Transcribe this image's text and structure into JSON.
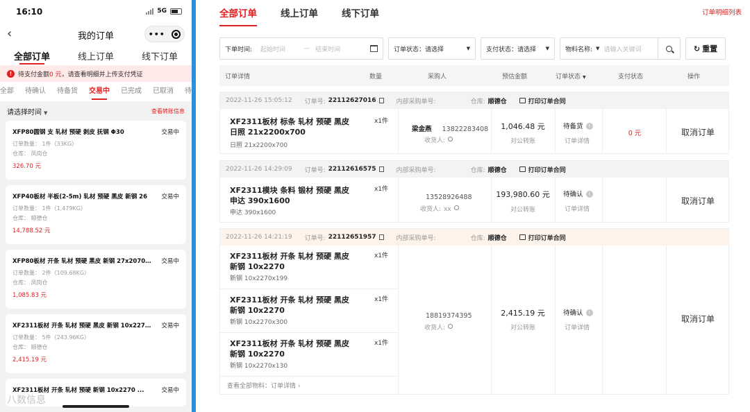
{
  "mobile": {
    "status_time": "16:10",
    "network": "5G",
    "nav_title": "我的订单",
    "back_icon": "chevron-left-icon",
    "tabs": [
      "全部订单",
      "线上订单",
      "线下订单"
    ],
    "notice": {
      "prefix": "待支付金额",
      "amount": "0 元",
      "suffix": "，请查看明细并上传支付凭证"
    },
    "status_tabs": [
      "全部",
      "待确认",
      "待备货",
      "交易中",
      "已完成",
      "已取消",
      "待支"
    ],
    "filter_label": "请选择时间",
    "transfer_link": "查看转账信息",
    "cards": [
      {
        "title": "XFP80圆钢 支 轧材 预硬 剥皮 抚钢 Φ30",
        "status": "交易中",
        "qty": "订单数量： 1件（33KG）",
        "warehouse": "仓库： 凤岗仓",
        "price": "326.70 元"
      },
      {
        "title": "XFP40板材 半板(2-5m) 轧材 预硬 黑皮 新钢 26",
        "status": "交易中",
        "qty": "订单数量： 1件（1,479KG）",
        "warehouse": "仓库： 顺德仓",
        "price": "14,788.52 元"
      },
      {
        "title": "XFP80板材 开条 轧材 预硬 黑皮 新钢 27x2070 ...",
        "status": "交易中",
        "qty": "订单数量： 2件（109.68KG）",
        "warehouse": "仓库： 凤岗仓",
        "price": "1,085.83 元"
      },
      {
        "title": "XF2311板材 开条 轧材 预硬 黑皮 新钢 10x2270 ...",
        "status": "交易中",
        "qty": "订单数量： 5件（243.96KG）",
        "warehouse": "仓库： 顺德仓",
        "price": "2,415.19 元"
      },
      {
        "title": "XF2311板材 开条 轧材 预硬 新钢 10x2270 ...",
        "status": "交易中"
      }
    ],
    "watermark": "八数信息"
  },
  "desktop": {
    "tabs": [
      "全部订单",
      "线上订单",
      "线下订单"
    ],
    "top_link": "订单明细列表",
    "filters": {
      "date_label": "下单时间:",
      "start_placeholder": "起始时间",
      "end_placeholder": "结束时间",
      "order_status_label": "订单状态：",
      "order_status_value": "请选择",
      "pay_status_label": "支付状态：",
      "pay_status_value": "请选择",
      "material_label": "物料名称:",
      "material_placeholder": "请输入关键词",
      "reset_label": "重置"
    },
    "table_headers": {
      "detail": "订单详情",
      "qty": "数量",
      "buyer": "采购人",
      "amount": "预估金额",
      "order_status": "订单状态",
      "pay_status": "支付状态",
      "action": "操作"
    },
    "order_no_label": "订单号:",
    "internal_no_label": "内部采购单号:",
    "warehouse_label": "仓库:",
    "print_label": "打印订单合同",
    "receiver_label": "收货人:",
    "pay_type": "对公转账",
    "detail_link": "订单详情",
    "cancel_label": "取消订单",
    "orders": [
      {
        "time": "2022-11-26 15:05:12",
        "order_no": "22112627016",
        "warehouse": "顺德仓",
        "items": [
          {
            "name": "XF2311板材 标条 轧材 预硬 黑皮 日照 21x2200x700",
            "spec": "日照 21x2200x700",
            "qty": "x1件"
          }
        ],
        "buyer_name": "梁金燕",
        "buyer_phone": "13822283408",
        "receiver": "",
        "amount": "1,046.48 元",
        "status": "待备货",
        "pay_status": "0 元"
      },
      {
        "time": "2022-11-26 14:29:09",
        "order_no": "22112616575",
        "warehouse": "顺德仓",
        "items": [
          {
            "name": "XF2311模块 条料 锻材 预硬 黑皮 申达 390x1600",
            "spec": "申达 390x1600",
            "qty": "x1件"
          }
        ],
        "buyer_name": "",
        "buyer_phone": "13528926488",
        "receiver": "xx",
        "amount": "193,980.60 元",
        "status": "待确认",
        "pay_status": ""
      },
      {
        "time": "2022-11-26 14:21:19",
        "order_no": "22112651957",
        "warehouse": "顺德仓",
        "items": [
          {
            "name": "XF2311板材 开条 轧材 预硬 黑皮 新钢 10x2270",
            "spec": "新钢 10x2270x199",
            "qty": "x1件"
          },
          {
            "name": "XF2311板材 开条 轧材 预硬 黑皮 新钢 10x2270",
            "spec": "新钢 10x2270x300",
            "qty": "x1件"
          },
          {
            "name": "XF2311板材 开条 轧材 预硬 黑皮 新钢 10x2270",
            "spec": "新钢 10x2270x130",
            "qty": "x1件"
          }
        ],
        "view_all": "查看全部物料：订单详情",
        "buyer_name": "",
        "buyer_phone": "18819374395",
        "receiver": "",
        "amount": "2,415.19 元",
        "status": "待确认",
        "pay_status": ""
      }
    ]
  },
  "colors": {
    "accent": "#e02020",
    "divider": "#2f8ed8"
  }
}
